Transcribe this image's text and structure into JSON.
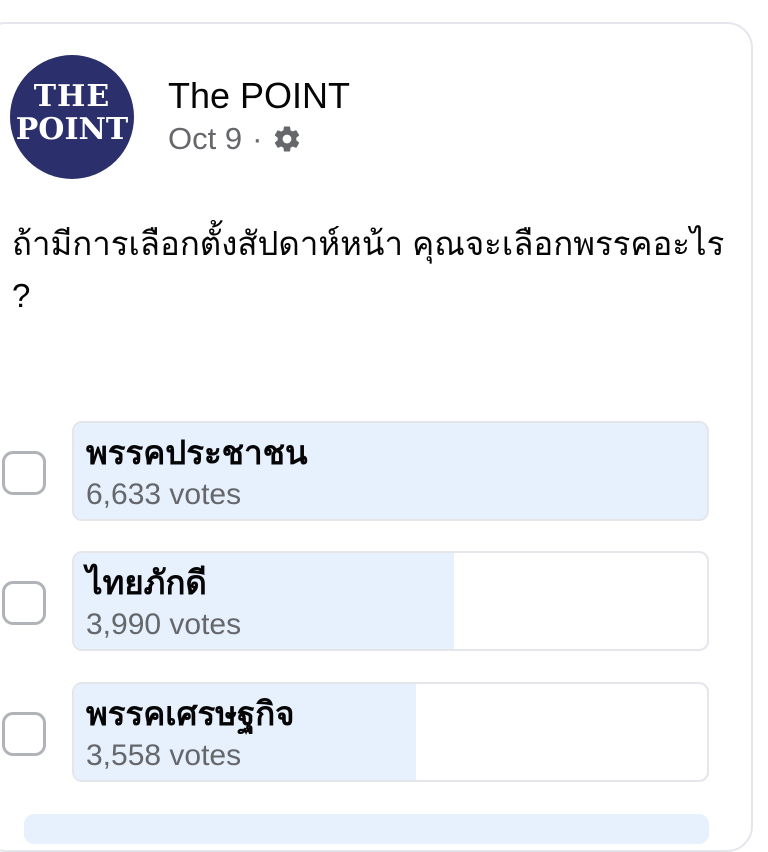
{
  "post": {
    "page_name": "The POINT",
    "avatar": {
      "line1": "THE",
      "line2": "POINT"
    },
    "date": "Oct 9",
    "separator": "·",
    "privacy_icon": "gear-icon",
    "question": "ถ้ามีการเลือกตั้งสัปดาห์หน้า คุณจะเลือกพรรคอะไร ?"
  },
  "poll": {
    "accent_fill": "#e7f0fd",
    "options": [
      {
        "label": "พรรคประชาชน",
        "votes": "6,633 votes",
        "share": 1.0
      },
      {
        "label": "ไทยภักดี",
        "votes": "3,990 votes",
        "share": 0.6
      },
      {
        "label": "พรรคเศรษฐกิจ",
        "votes": "3,558 votes",
        "share": 0.54
      }
    ]
  }
}
